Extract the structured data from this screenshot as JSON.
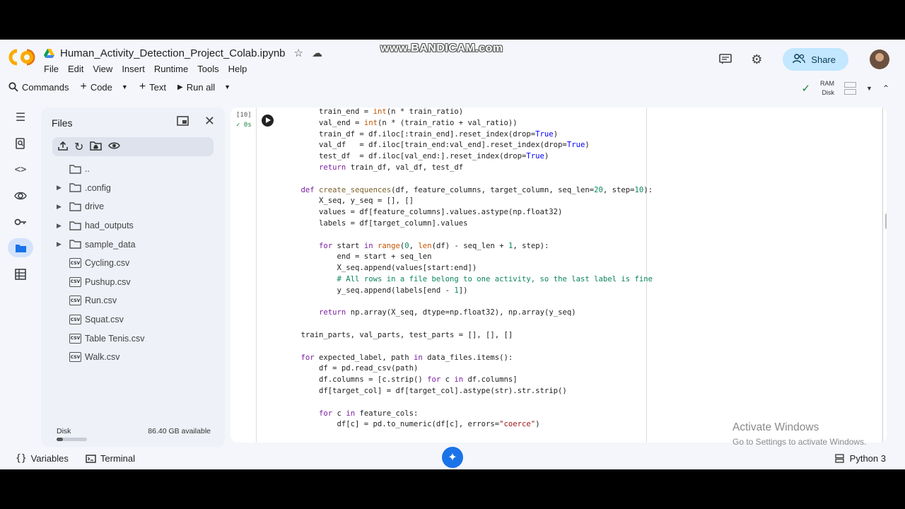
{
  "app": {
    "logo_text": "CO",
    "notebook_title": "Human_Activity_Detection_Project_Colab.ipynb",
    "watermark": "www.BANDICAM.com",
    "share_label": "Share"
  },
  "menu": [
    "File",
    "Edit",
    "View",
    "Insert",
    "Runtime",
    "Tools",
    "Help"
  ],
  "toolbar": {
    "commands": "Commands",
    "code": "Code",
    "text": "Text",
    "run_all": "Run all",
    "ram_label": "RAM",
    "disk_label": "Disk"
  },
  "files_panel": {
    "title": "Files",
    "items": [
      {
        "label": "..",
        "kind": "folder",
        "expandable": false
      },
      {
        "label": ".config",
        "kind": "folder",
        "expandable": true
      },
      {
        "label": "drive",
        "kind": "folder",
        "expandable": true
      },
      {
        "label": "had_outputs",
        "kind": "folder",
        "expandable": true
      },
      {
        "label": "sample_data",
        "kind": "folder",
        "expandable": true
      },
      {
        "label": "Cycling.csv",
        "kind": "csv",
        "expandable": false
      },
      {
        "label": "Pushup.csv",
        "kind": "csv",
        "expandable": false
      },
      {
        "label": "Run.csv",
        "kind": "csv",
        "expandable": false
      },
      {
        "label": "Squat.csv",
        "kind": "csv",
        "expandable": false
      },
      {
        "label": "Table Tenis.csv",
        "kind": "csv",
        "expandable": false
      },
      {
        "label": "Walk.csv",
        "kind": "csv",
        "expandable": false
      }
    ],
    "csv_badge": "CSV",
    "disk_label": "Disk",
    "disk_available": "86.40 GB available",
    "disk_used_fraction": 0.2
  },
  "cell": {
    "execution_count": "[10]",
    "run_time": "0s",
    "code_lines": [
      "        train_end = int(n * train_ratio)",
      "        val_end = int(n * (train_ratio + val_ratio))",
      "        train_df = df.iloc[:train_end].reset_index(drop=True)",
      "        val_df   = df.iloc[train_end:val_end].reset_index(drop=True)",
      "        test_df  = df.iloc[val_end:].reset_index(drop=True)",
      "        return train_df, val_df, test_df",
      "",
      "    def create_sequences(df, feature_columns, target_column, seq_len=20, step=10):",
      "        X_seq, y_seq = [], []",
      "        values = df[feature_columns].values.astype(np.float32)",
      "        labels = df[target_column].values",
      "",
      "        for start in range(0, len(df) - seq_len + 1, step):",
      "            end = start + seq_len",
      "            X_seq.append(values[start:end])",
      "            # All rows in a file belong to one activity, so the last label is fine",
      "            y_seq.append(labels[end - 1])",
      "",
      "        return np.array(X_seq, dtype=np.float32), np.array(y_seq)",
      "",
      "    train_parts, val_parts, test_parts = [], [], []",
      "",
      "    for expected_label, path in data_files.items():",
      "        df = pd.read_csv(path)",
      "        df.columns = [c.strip() for c in df.columns]",
      "        df[target_col] = df[target_col].astype(str).str.strip()",
      "",
      "        for c in feature_cols:",
      "            df[c] = pd.to_numeric(df[c], errors=\"coerce\")"
    ]
  },
  "activate": {
    "line1": "Activate Windows",
    "line2": "Go to Settings to activate Windows."
  },
  "bottom_bar": {
    "variables": "Variables",
    "terminal": "Terminal",
    "runtime": "Python 3"
  },
  "colors": {
    "accent": "#1a73e8",
    "share_bg": "#c2e7ff",
    "panel_bg": "#eef1f8",
    "success": "#188038"
  }
}
